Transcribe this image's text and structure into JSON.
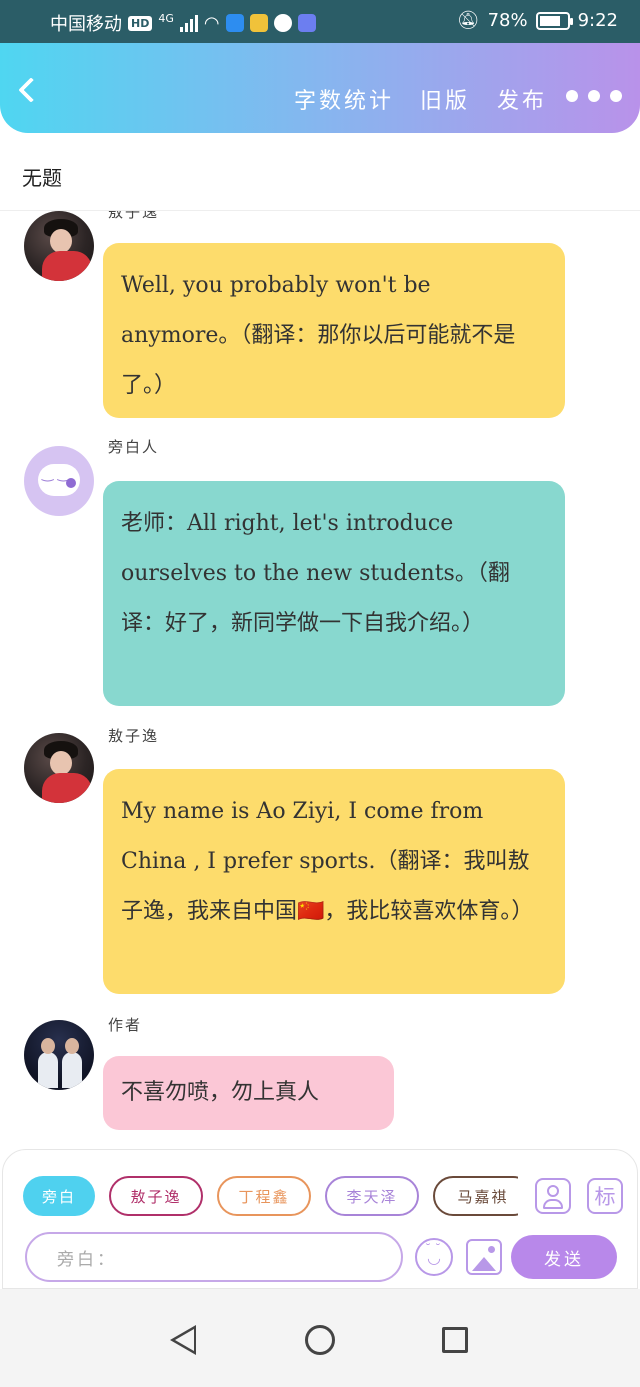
{
  "status_bar": {
    "carrier": "中国移动",
    "network": "HD",
    "signal": "4G",
    "battery": "78%",
    "battery_level": 0.78,
    "time": "9:22"
  },
  "header": {
    "word_count": "字数统计",
    "old_version": "旧版",
    "publish": "发布"
  },
  "document": {
    "title": "无题"
  },
  "messages": [
    {
      "name": "敖子逸",
      "text": "Well, you probably won't be anymore。（翻译：那你以后可能就不是了。）",
      "color": "#fddc6c"
    },
    {
      "name": "旁白人",
      "text": "老师：All right, let's introduce ourselves to the new students。（翻译：好了，新同学做一下自我介绍。）",
      "color": "#88d8cf"
    },
    {
      "name": "敖子逸",
      "text": "My name is Ao Ziyi, I come from China , I prefer sports.（翻译：我叫敖子逸，我来自中国🇨🇳，我比较喜欢体育。）",
      "color": "#fddc6c"
    },
    {
      "name": "作者",
      "text": "不喜勿喷，勿上真人",
      "color": "#fbc7d6"
    }
  ],
  "composer": {
    "characters": [
      {
        "label": "旁白",
        "color": "#4fd1ef"
      },
      {
        "label": "敖子逸",
        "color": "#b0306a"
      },
      {
        "label": "丁程鑫",
        "color": "#e8955c"
      },
      {
        "label": "李天泽",
        "color": "#a884d8"
      },
      {
        "label": "马嘉祺",
        "color": "#6a4a3a"
      }
    ],
    "tag_label": "标",
    "input_placeholder": "旁白：",
    "send_label": "发送"
  },
  "icons": [
    "back-icon",
    "more-icon",
    "person-icon",
    "emoji-icon",
    "image-icon",
    "nav-back-icon",
    "nav-home-icon",
    "nav-recent-icon"
  ]
}
